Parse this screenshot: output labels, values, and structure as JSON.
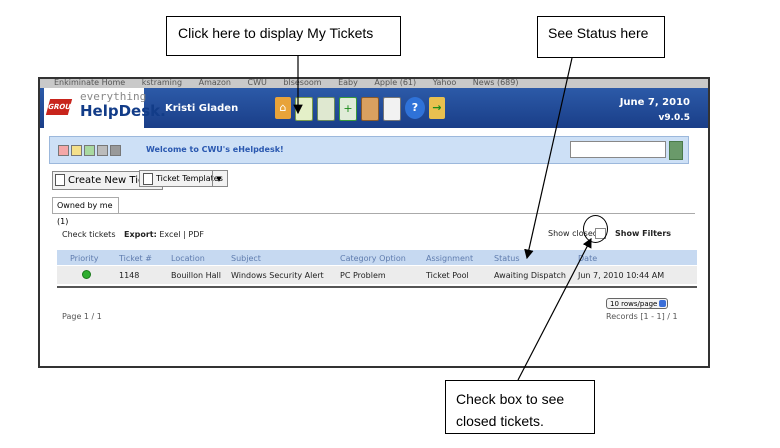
{
  "callouts": {
    "tickets": "Click here to display My Tickets",
    "status": "See Status here",
    "closed": "Check box to see closed tickets."
  },
  "browser": {
    "bookmarks": [
      "Enkiminate Home",
      "kstraming",
      "Amazon",
      "CWU",
      "blsesoom",
      "Eaby",
      "Apple (61)",
      "Yahoo",
      "News (689)"
    ]
  },
  "header": {
    "logo_top": "everything",
    "logo_bottom": "HelpDesk.",
    "logo_mark": "GROUP",
    "user": "Kristi Gladen",
    "date": "June 7, 2010",
    "version": "v9.0.5",
    "toolbar_icons": [
      "home-icon",
      "my-tickets-icon",
      "tickets-list-icon",
      "new-ticket-icon",
      "inventory-icon",
      "reports-icon",
      "help-icon",
      "logout-icon"
    ]
  },
  "welcome": {
    "text": "Welcome to CWU's eHelpdesk!",
    "search_value": "",
    "swatches": [
      "#f4a7a7",
      "#f4e08a",
      "#a9d9a0",
      "#bbbbbb",
      "#999999"
    ]
  },
  "actions": {
    "create": "Create New Ticket",
    "templates": "Ticket Templates"
  },
  "tabs": {
    "owned": "Owned by me (1)"
  },
  "list": {
    "check_tickets": "Check tickets",
    "export_label": "Export:",
    "export_excel": "Excel",
    "export_sep": "|",
    "export_pdf": "PDF",
    "show_closed": "Show closed",
    "show_filters": "Show Filters"
  },
  "grid": {
    "columns": [
      "Priority",
      "Ticket #",
      "Location",
      "Subject",
      "Category Option",
      "Assignment",
      "Status",
      "Date"
    ],
    "rows": [
      {
        "priority": "green",
        "ticket": "1148",
        "location": "Bouillon Hall",
        "subject": "Windows Security Alert",
        "category": "PC Problem",
        "assignment": "Ticket Pool",
        "status": "Awaiting Dispatch",
        "date": "Jun 7, 2010 10:44 AM"
      }
    ]
  },
  "paging": {
    "page": "Page 1 / 1",
    "rows_per_page": "10 rows/page",
    "records": "Records [1 - 1] / 1"
  }
}
